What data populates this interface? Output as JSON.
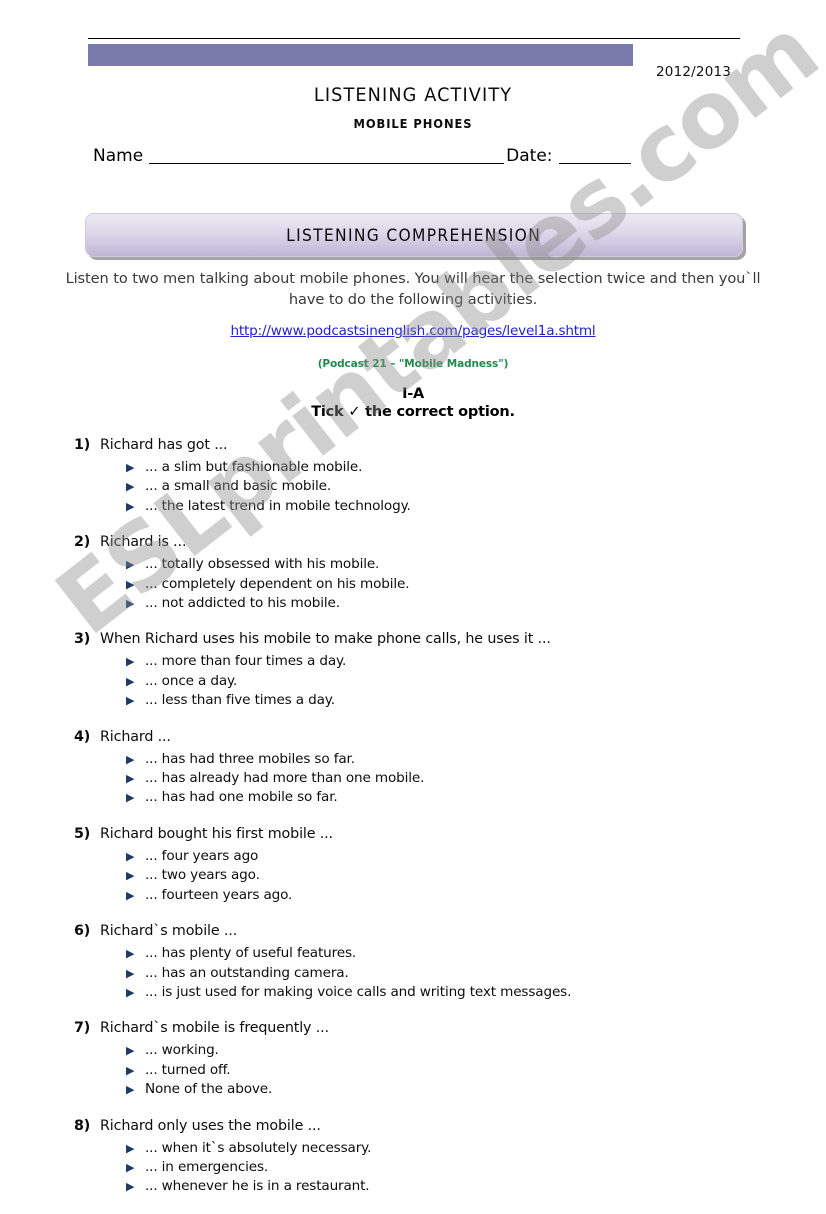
{
  "document": {
    "year": "2012/2013",
    "title": "LISTENING ACTIVITY",
    "subtitle": "MOBILE PHONES"
  },
  "name_date": {
    "name_label": "Name",
    "date_label": "Date:",
    "name_value": "",
    "date_value": ""
  },
  "section": {
    "banner_title": "LISTENING  COMPREHENSION",
    "intro": "Listen to two men talking about mobile phones. You will hear the selection twice and then you`ll have to do the following activities.",
    "link_text": "http://www.podcastsinenglish.com/pages/level1a.shtml",
    "podcast_note": "(Podcast 21 – \"Mobile Madness\")"
  },
  "part": {
    "label": "I-A",
    "instruction_before": "Tick ",
    "tick": "✓",
    "instruction_after": " the correct option."
  },
  "bullet_glyph": "▶",
  "colors": {
    "masthead_bar": "#7b7bab",
    "banner_top": "#eae7f2",
    "banner_bottom": "#bfb6d5",
    "link": "#2222cc",
    "podcast_note": "#1f8a4c",
    "bullet": "#1f3864",
    "watermark": "rgba(140,140,140,0.42)"
  },
  "watermark": {
    "text": "ESLprintables.com"
  },
  "questions": [
    {
      "number": "1)",
      "stem": "Richard has got ...",
      "options": [
        "... a slim but fashionable mobile.",
        "... a small and basic mobile.",
        "... the latest trend in mobile technology."
      ]
    },
    {
      "number": "2)",
      "stem": "Richard is ...",
      "options": [
        "... totally obsessed with his mobile.",
        "... completely dependent on his mobile.",
        "... not addicted to his mobile."
      ]
    },
    {
      "number": "3)",
      "stem": "When Richard uses his mobile to make phone calls, he uses it ...",
      "options": [
        "... more than four times a day.",
        "... once a day.",
        "... less than five times a day."
      ]
    },
    {
      "number": "4)",
      "stem": "Richard ...",
      "options": [
        "... has had three mobiles so far.",
        "... has already had more than one mobile.",
        "... has had one mobile so far."
      ]
    },
    {
      "number": "5)",
      "stem": "Richard bought his first mobile ...",
      "options": [
        "... four years ago",
        "... two years ago.",
        "... fourteen years ago."
      ]
    },
    {
      "number": "6)",
      "stem": "Richard`s mobile ...",
      "options": [
        "... has plenty of useful features.",
        "... has an outstanding camera.",
        "... is just used for making voice calls and writing text messages."
      ]
    },
    {
      "number": "7)",
      "stem": "Richard`s mobile is frequently ...",
      "options": [
        "... working.",
        "... turned off.",
        "None of the above."
      ]
    },
    {
      "number": "8)",
      "stem": "Richard only uses the mobile ...",
      "options": [
        "... when it`s absolutely necessary.",
        "... in emergencies.",
        "... whenever he is in a restaurant."
      ]
    }
  ]
}
